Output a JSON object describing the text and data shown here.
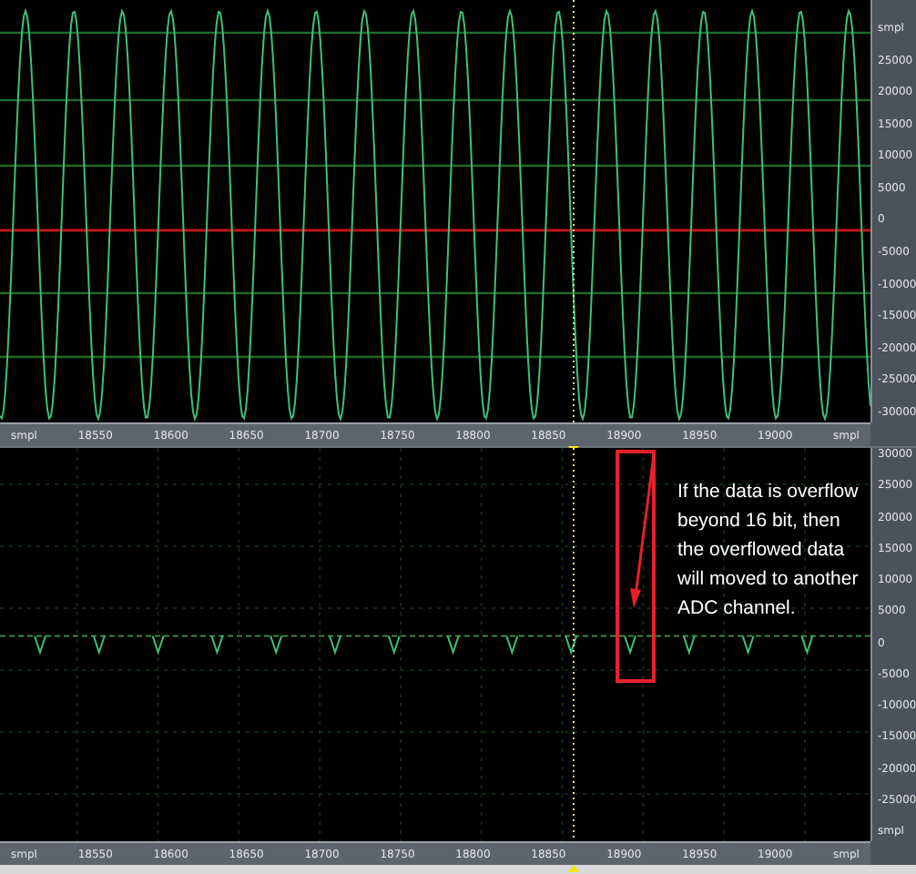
{
  "panels": [
    {
      "kind": "sine",
      "y_labels": [
        "smpl",
        "25000",
        "20000",
        "15000",
        "10000",
        "5000",
        "0",
        "-5000",
        "-10000",
        "-15000",
        "-20000",
        "-25000",
        "-30000"
      ],
      "x_labels": [
        "smpl",
        "18550",
        "18600",
        "18650",
        "18700",
        "18750",
        "18800",
        "18850",
        "18900",
        "18950",
        "19000",
        "smpl"
      ]
    },
    {
      "kind": "dips",
      "y_labels": [
        "30000",
        "25000",
        "20000",
        "15000",
        "10000",
        "5000",
        "0",
        "-5000",
        "-10000",
        "-15000",
        "-20000",
        "-25000",
        "smpl"
      ],
      "x_labels": [
        "smpl",
        "18550",
        "18600",
        "18650",
        "18700",
        "18750",
        "18800",
        "18850",
        "18900",
        "18950",
        "19000",
        "smpl"
      ]
    }
  ],
  "annotation": {
    "text": "If the data is overflow beyond 16 bit, then the overflowed data will moved to another ADC channel."
  }
}
